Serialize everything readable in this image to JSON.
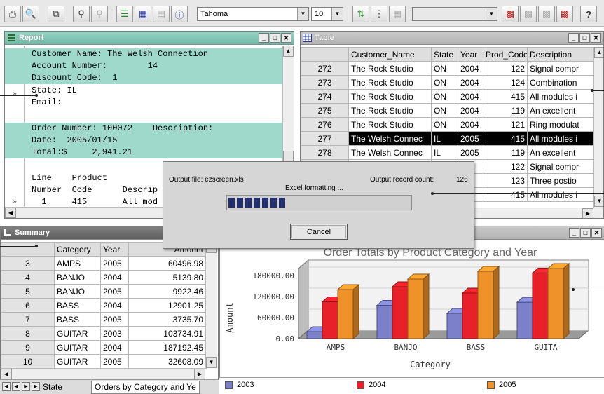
{
  "toolbar": {
    "font_name": "Tahoma",
    "font_size": "10",
    "help_label": "?"
  },
  "report": {
    "title": "Report",
    "lines": [
      {
        "text": "Customer Name: The Welsh Connection",
        "teal": true
      },
      {
        "text": "Account Number:        14",
        "teal": true
      },
      {
        "text": "Discount Code:  1",
        "teal": true
      },
      {
        "text": "State: IL",
        "teal": false
      },
      {
        "text": "Email:",
        "teal": false
      },
      {
        "text": "",
        "teal": false
      },
      {
        "text": "Order Number: 100072    Description:",
        "teal": true
      },
      {
        "text": "Date:  2005/01/15",
        "teal": true
      },
      {
        "text": "Total:$     2,941.21",
        "teal": true
      },
      {
        "text": "",
        "teal": false
      },
      {
        "text": "Line    Product",
        "teal": false
      },
      {
        "text": "Number  Code      Descrip",
        "teal": false
      },
      {
        "text": "  1     415       All mod",
        "teal": false
      }
    ]
  },
  "table": {
    "title": "Table",
    "columns": [
      "Customer_Name",
      "State",
      "Year",
      "Prod_Code",
      "Description"
    ],
    "rows": [
      {
        "n": "272",
        "c": [
          "The Rock Studio",
          "ON",
          "2004",
          "122",
          "Signal compr"
        ]
      },
      {
        "n": "273",
        "c": [
          "The Rock Studio",
          "ON",
          "2004",
          "124",
          "Combination"
        ]
      },
      {
        "n": "274",
        "c": [
          "The Rock Studio",
          "ON",
          "2004",
          "415",
          "All modules i"
        ]
      },
      {
        "n": "275",
        "c": [
          "The Rock Studio",
          "ON",
          "2004",
          "119",
          "An excellent"
        ]
      },
      {
        "n": "276",
        "c": [
          "The Rock Studio",
          "ON",
          "2004",
          "121",
          "Ring modulat"
        ]
      },
      {
        "n": "277",
        "c": [
          "The Welsh Connec",
          "IL",
          "2005",
          "415",
          "All modules i"
        ],
        "selected": true
      },
      {
        "n": "278",
        "c": [
          "The Welsh Connec",
          "IL",
          "2005",
          "119",
          "An excellent"
        ]
      },
      {
        "n": "",
        "c": [
          "",
          "",
          "5",
          "122",
          "Signal compr"
        ]
      },
      {
        "n": "",
        "c": [
          "",
          "",
          "5",
          "123",
          "Three postio"
        ]
      },
      {
        "n": "",
        "c": [
          "",
          "",
          "5",
          "415",
          "All modules i"
        ]
      }
    ]
  },
  "dialog": {
    "output_file": "Output file: ezscreen.xls",
    "record_count_label": "Output record count:",
    "record_count": "126",
    "status": "Excel formatting ...",
    "progress": 0.34,
    "cancel_label": "Cancel"
  },
  "summary": {
    "title": "Summary",
    "columns": [
      "Category",
      "Year",
      "Amount"
    ],
    "rows": [
      {
        "n": "3",
        "c": [
          "AMPS",
          "2005",
          "60496.98"
        ]
      },
      {
        "n": "4",
        "c": [
          "BANJO",
          "2004",
          "5139.80"
        ]
      },
      {
        "n": "5",
        "c": [
          "BANJO",
          "2005",
          "9922.46"
        ]
      },
      {
        "n": "6",
        "c": [
          "BASS",
          "2004",
          "12901.25"
        ]
      },
      {
        "n": "7",
        "c": [
          "BASS",
          "2005",
          "3735.70"
        ]
      },
      {
        "n": "8",
        "c": [
          "GUITAR",
          "2003",
          "103734.91"
        ]
      },
      {
        "n": "9",
        "c": [
          "GUITAR",
          "2004",
          "187192.45"
        ]
      },
      {
        "n": "10",
        "c": [
          "GUITAR",
          "2005",
          "32608.09"
        ]
      }
    ],
    "tabs": [
      "State",
      "Orders by Category and Ye"
    ]
  },
  "chart_data": {
    "type": "bar",
    "title": "Order Totals by Product Category and Year",
    "xlabel": "Category",
    "ylabel": "Amount",
    "categories": [
      "AMPS",
      "BANJO",
      "BASS",
      "GUITA"
    ],
    "yticks": [
      "0.00",
      "60000.00",
      "120000.00",
      "180000.00"
    ],
    "ylim": [
      0,
      200000
    ],
    "series": [
      {
        "name": "2003",
        "color": "#7b80c9",
        "values": [
          20000,
          95000,
          72000,
          103735
        ]
      },
      {
        "name": "2004",
        "color": "#e8202a",
        "values": [
          105000,
          148000,
          130000,
          187192
        ]
      },
      {
        "name": "2005",
        "color": "#f0922a",
        "values": [
          140000,
          170000,
          192000,
          200000
        ]
      }
    ],
    "legend_position": "bottom",
    "style": "3d"
  }
}
